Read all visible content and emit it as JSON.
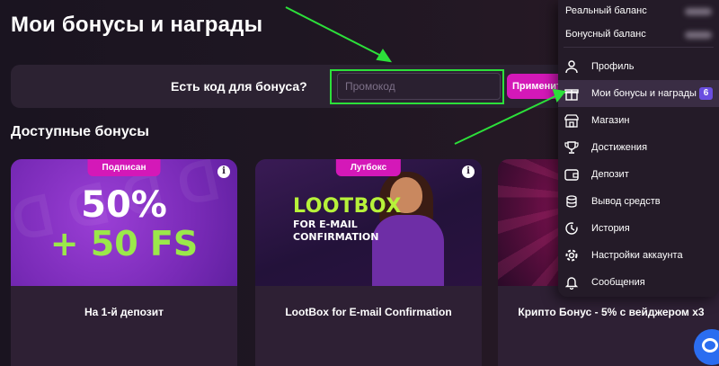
{
  "page": {
    "title": "Мои бонусы и награды"
  },
  "promo": {
    "question": "Есть код для бонуса?",
    "placeholder": "Промокод",
    "apply_label": "Применить"
  },
  "section": {
    "title": "Доступные бонусы"
  },
  "cards": [
    {
      "tag": "Подписан",
      "title": "На 1-й депозит",
      "banner_line1": "50%",
      "banner_line2": "+ 50 FS"
    },
    {
      "tag": "Лутбокс",
      "title": "LootBox for E-mail Confirmation",
      "banner_title": "LOOTBOX",
      "banner_sub": "FOR E-MAIL CONFIRMATION"
    },
    {
      "tag": "",
      "title": "Крипто Бонус - 5% с вейджером х3"
    }
  ],
  "menu": {
    "real_balance_label": "Реальный баланс",
    "bonus_balance_label": "Бонусный баланс",
    "items": [
      {
        "label": "Профиль",
        "icon": "person-icon"
      },
      {
        "label": "Мои бонусы и награды",
        "icon": "gift-icon",
        "badge": "6"
      },
      {
        "label": "Магазин",
        "icon": "store-icon"
      },
      {
        "label": "Достижения",
        "icon": "trophy-icon"
      },
      {
        "label": "Депозит",
        "icon": "wallet-icon"
      },
      {
        "label": "Вывод средств",
        "icon": "coins-icon"
      },
      {
        "label": "История",
        "icon": "history-icon"
      },
      {
        "label": "Настройки аккаунта",
        "icon": "gear-icon"
      },
      {
        "label": "Сообщения",
        "icon": "bell-icon"
      }
    ]
  },
  "colors": {
    "accent": "#d418b8",
    "highlight": "#2ce03a",
    "badge": "#6a4ee0",
    "chat": "#2b6df0"
  }
}
